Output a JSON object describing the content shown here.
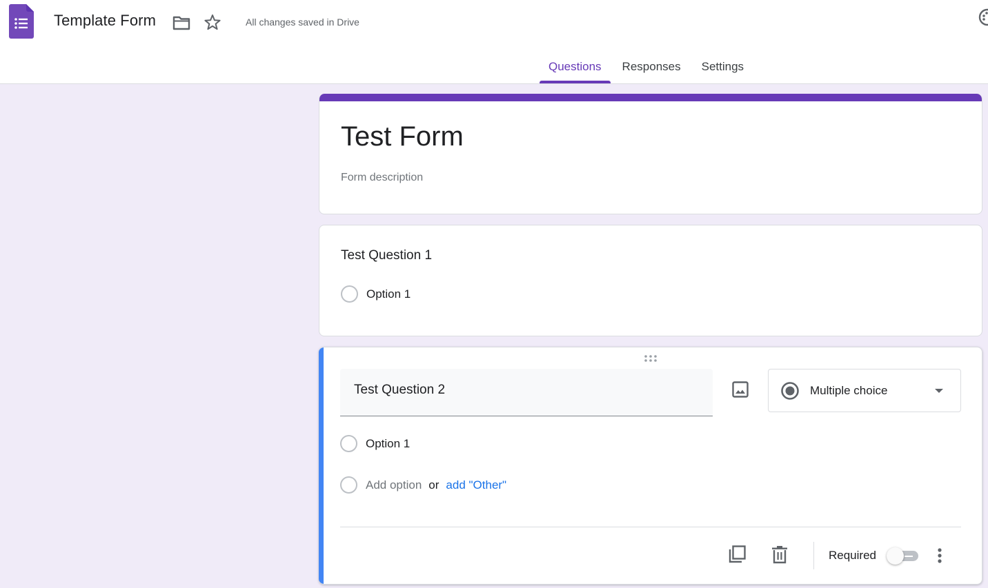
{
  "header": {
    "app_icon": "google-forms-logo",
    "doc_title": "Template Form",
    "folder_icon": "folder-icon",
    "star_icon": "star-icon",
    "save_status": "All changes saved in Drive",
    "palette_icon": "palette-icon"
  },
  "tabs": [
    {
      "label": "Questions",
      "active": true
    },
    {
      "label": "Responses",
      "active": false
    },
    {
      "label": "Settings",
      "active": false
    }
  ],
  "colors": {
    "theme": "#673ab7",
    "background": "#f0ebf8",
    "active_card_accent": "#4285f4",
    "link": "#1a73e8"
  },
  "form": {
    "title": "Test Form",
    "description_placeholder": "Form description"
  },
  "questions": [
    {
      "title": "Test Question 1",
      "options": [
        "Option 1"
      ]
    },
    {
      "title": "Test Question 2",
      "type": "Multiple choice",
      "options": [
        "Option 1"
      ],
      "add_option": "Add option",
      "or": "or",
      "add_other": "add \"Other\"",
      "required_label": "Required",
      "required": false
    }
  ]
}
